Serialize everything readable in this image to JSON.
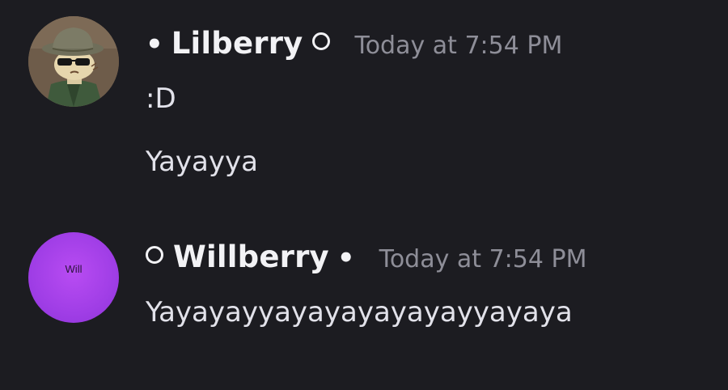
{
  "messages": [
    {
      "username": "Lilberry",
      "prefix_glyph": "•",
      "timestamp": "Today at 7:54 PM",
      "lines": [
        ":D",
        "Yayayya"
      ]
    },
    {
      "username": "Willberry",
      "suffix_glyph": "•",
      "avatar_text": "Will",
      "timestamp": "Today at 7:54 PM",
      "lines": [
        "Yayayayyayayayayayayyayaya"
      ]
    }
  ],
  "colors": {
    "background": "#1c1c21",
    "username": "#f2f2f5",
    "timestamp": "#8e8e98",
    "message_text": "#e2e2ea",
    "will_avatar": "#a03ee6"
  },
  "icons": {
    "status_ring": "ring-icon",
    "bullet": "bullet-dot"
  }
}
